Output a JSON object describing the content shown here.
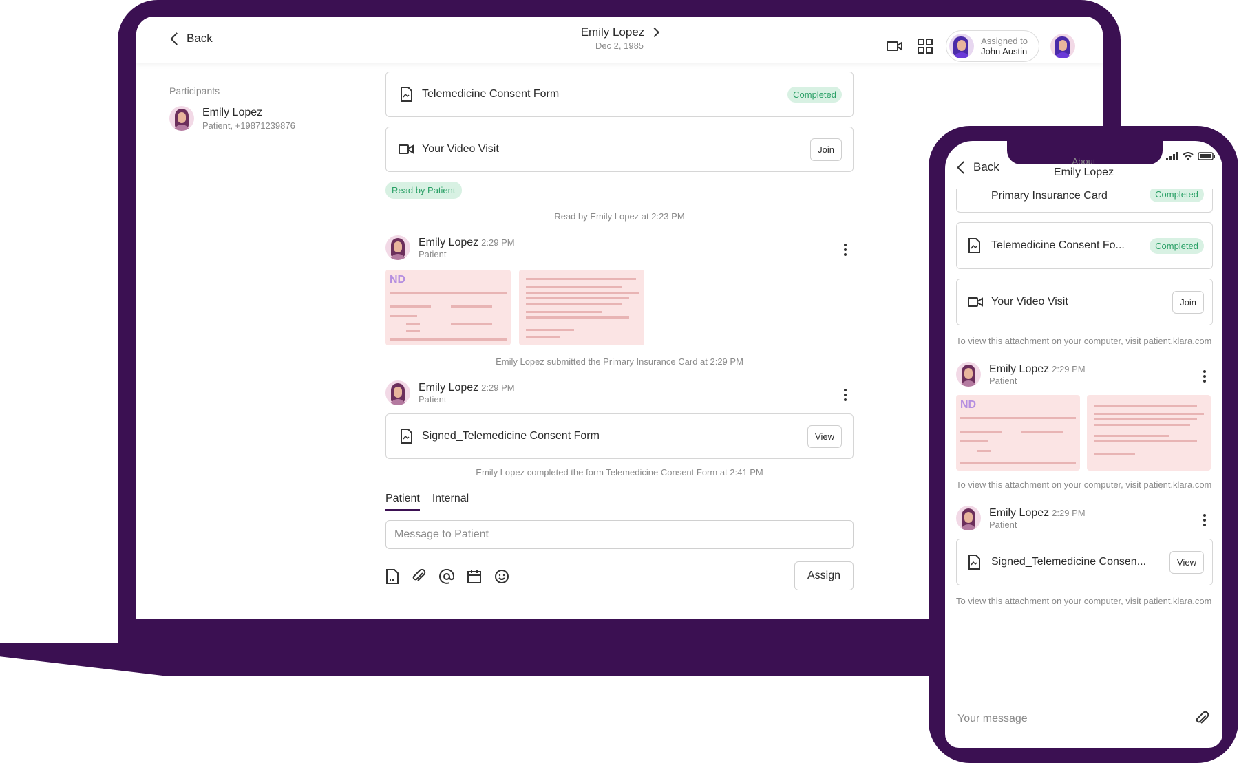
{
  "desktop": {
    "back_label": "Back",
    "patient_name": "Emily Lopez",
    "dob": "Dec 2, 1985",
    "assigned_label": "Assigned to",
    "assigned_name": "John Austin",
    "participants_label": "Participants",
    "participant_name": "Emily Lopez",
    "participant_sub": "Patient, +19871239876",
    "cards": [
      {
        "title": "Telemedicine Consent Form",
        "badge": "Completed"
      },
      {
        "title": "Your Video Visit",
        "button": "Join"
      }
    ],
    "read_badge": "Read by Patient",
    "read_line": "Read by Emily Lopez at 2:23 PM",
    "msg1": {
      "name": "Emily Lopez",
      "time": "2:29 PM",
      "role": "Patient"
    },
    "thumb_logo_text": "ND",
    "submitted_line": "Emily Lopez submitted the Primary Insurance Card at 2:29 PM",
    "msg2": {
      "name": "Emily Lopez",
      "time": "2:29 PM",
      "role": "Patient"
    },
    "signed_form": {
      "title": "Signed_Telemedicine Consent Form",
      "button": "View"
    },
    "completed_line": "Emily Lopez completed the form Telemedicine Consent Form at 2:41 PM",
    "tabs": [
      "Patient",
      "Internal"
    ],
    "message_placeholder": "Message to Patient",
    "assign_button": "Assign"
  },
  "phone": {
    "back_label": "Back",
    "about_label": "About",
    "about_name": "Emily Lopez",
    "partial_card": {
      "title": "Primary Insurance Card",
      "badge": "Completed"
    },
    "card_consent": {
      "title": "Telemedicine Consent Fo...",
      "badge": "Completed"
    },
    "card_video": {
      "title": "Your Video Visit",
      "button": "Join"
    },
    "note": "To view this attachment on your computer, visit patient.klara.com",
    "msg1": {
      "name": "Emily Lopez",
      "time": "2:29 PM",
      "role": "Patient"
    },
    "thumb_logo_text": "ND",
    "msg2": {
      "name": "Emily Lopez",
      "time": "2:29 PM",
      "role": "Patient"
    },
    "signed_card": {
      "title": "Signed_Telemedicine Consen...",
      "button": "View"
    },
    "input_placeholder": "Your message"
  },
  "colors": {
    "brand": "#3b1052",
    "success": "#2aa066",
    "success_bg": "#d8f1e3",
    "thumb_bg": "#fbe4e4"
  }
}
